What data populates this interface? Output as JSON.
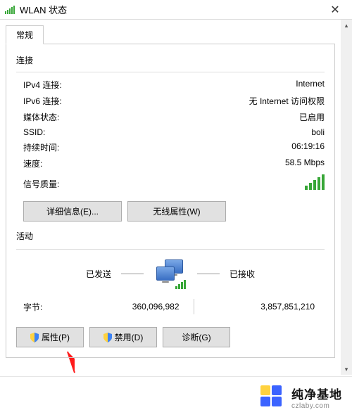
{
  "titlebar": {
    "title": "WLAN 状态",
    "close": "✕",
    "wifi_icon": "wifi-icon"
  },
  "tabs": {
    "general": "常规"
  },
  "connection": {
    "group_title": "连接",
    "ipv4_label": "IPv4 连接:",
    "ipv4_value": "Internet",
    "ipv6_label": "IPv6 连接:",
    "ipv6_value": "无 Internet 访问权限",
    "media_label": "媒体状态:",
    "media_value": "已启用",
    "ssid_label": "SSID:",
    "ssid_value": "boli",
    "duration_label": "持续时间:",
    "duration_value": "06:19:16",
    "speed_label": "速度:",
    "speed_value": "58.5 Mbps",
    "signal_label": "信号质量:",
    "details_btn": "详细信息(E)...",
    "wireless_props_btn": "无线属性(W)"
  },
  "activity": {
    "group_title": "活动",
    "sent_label": "已发送",
    "received_label": "已接收",
    "bytes_label": "字节:",
    "bytes_sent": "360,096,982",
    "bytes_received": "3,857,851,210"
  },
  "buttons": {
    "properties": "属性(P)",
    "disable": "禁用(D)",
    "diagnose": "诊断(G)"
  },
  "footer": {
    "brand": "纯净基地",
    "url": "czlaby.com"
  }
}
